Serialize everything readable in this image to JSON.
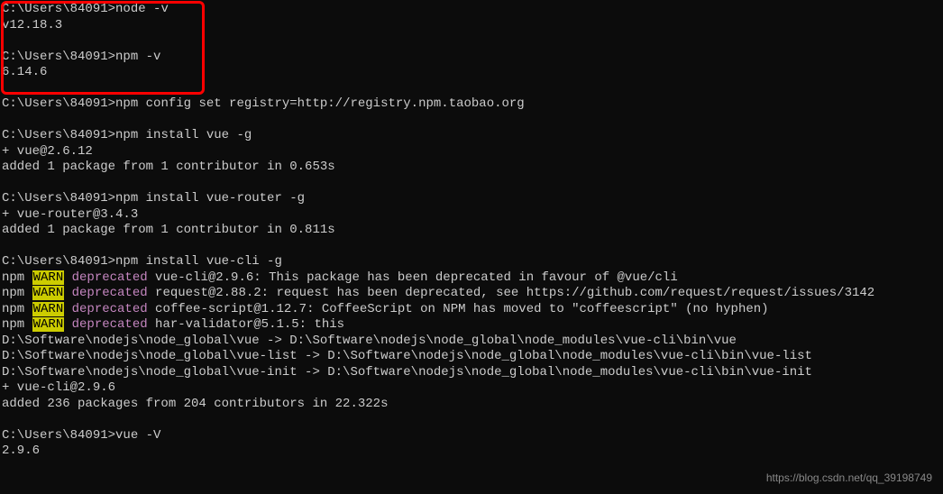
{
  "prompt": "C:\\Users\\84091>",
  "cmd1": "node -v",
  "out1": "v12.18.3",
  "cmd2": "npm -v",
  "out2": "6.14.6",
  "cmd3": "npm config set registry=http://registry.npm.taobao.org",
  "cmd4": "npm install vue -g",
  "out4a": "+ vue@2.6.12",
  "out4b": "added 1 package from 1 contributor in 0.653s",
  "cmd5": "npm install vue-router -g",
  "out5a": "+ vue-router@3.4.3",
  "out5b": "added 1 package from 1 contributor in 0.811s",
  "cmd6": "npm install vue-cli -g",
  "npm_prefix": "npm ",
  "warn_label": "WARN",
  "dep_label": " deprecated",
  "warn1": " vue-cli@2.9.6: This package has been deprecated in favour of @vue/cli",
  "warn2": " request@2.88.2: request has been deprecated, see https://github.com/request/request/issues/3142",
  "warn3": " coffee-script@1.12.7: CoffeeScript on NPM has moved to \"coffeescript\" (no hyphen)",
  "warn4": " har-validator@5.1.5: this",
  "link1": "D:\\Software\\nodejs\\node_global\\vue -> D:\\Software\\nodejs\\node_global\\node_modules\\vue-cli\\bin\\vue",
  "link2": "D:\\Software\\nodejs\\node_global\\vue-list -> D:\\Software\\nodejs\\node_global\\node_modules\\vue-cli\\bin\\vue-list",
  "link3": "D:\\Software\\nodejs\\node_global\\vue-init -> D:\\Software\\nodejs\\node_global\\node_modules\\vue-cli\\bin\\vue-init",
  "out6a": "+ vue-cli@2.9.6",
  "out6b": "added 236 packages from 204 contributors in 22.322s",
  "cmd7": "vue -V",
  "out7": "2.9.6",
  "watermark": "https://blog.csdn.net/qq_39198749"
}
